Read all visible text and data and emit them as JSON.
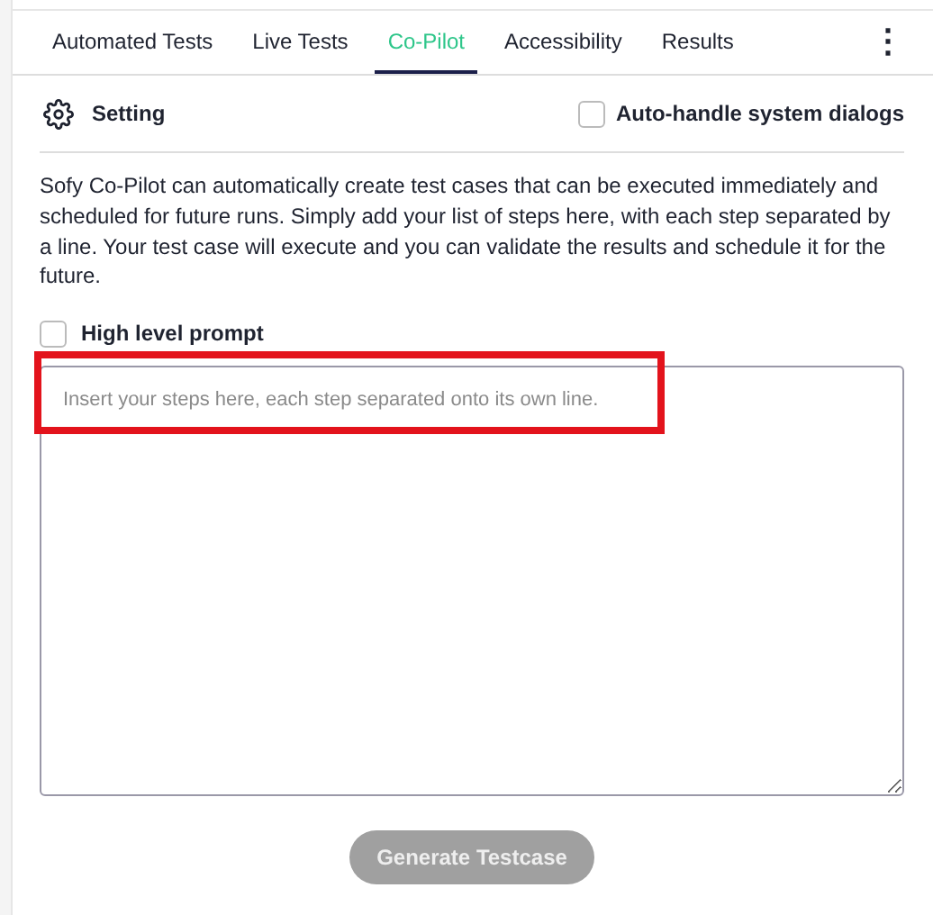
{
  "tabs": [
    {
      "label": "Automated Tests",
      "selected": false
    },
    {
      "label": "Live Tests",
      "selected": false
    },
    {
      "label": "Co-Pilot",
      "selected": true
    },
    {
      "label": "Accessibility",
      "selected": false
    },
    {
      "label": "Results",
      "selected": false
    }
  ],
  "more_menu": "⋮",
  "setting": {
    "label": "Setting"
  },
  "auto_handle": {
    "label": "Auto-handle system dialogs",
    "checked": false
  },
  "description": "Sofy Co-Pilot can automatically create test cases that can be executed immediately and scheduled for future runs. Simply add your list of steps here, with each step separated by a line. Your test case will execute and you can validate the results and schedule it for the future.",
  "high_level_prompt": {
    "label": "High level prompt",
    "checked": false
  },
  "steps_field": {
    "placeholder": "Insert your steps here, each step separated onto its own line.",
    "highlighted": true
  },
  "generate_button": {
    "label": "Generate Testcase",
    "disabled": true
  }
}
